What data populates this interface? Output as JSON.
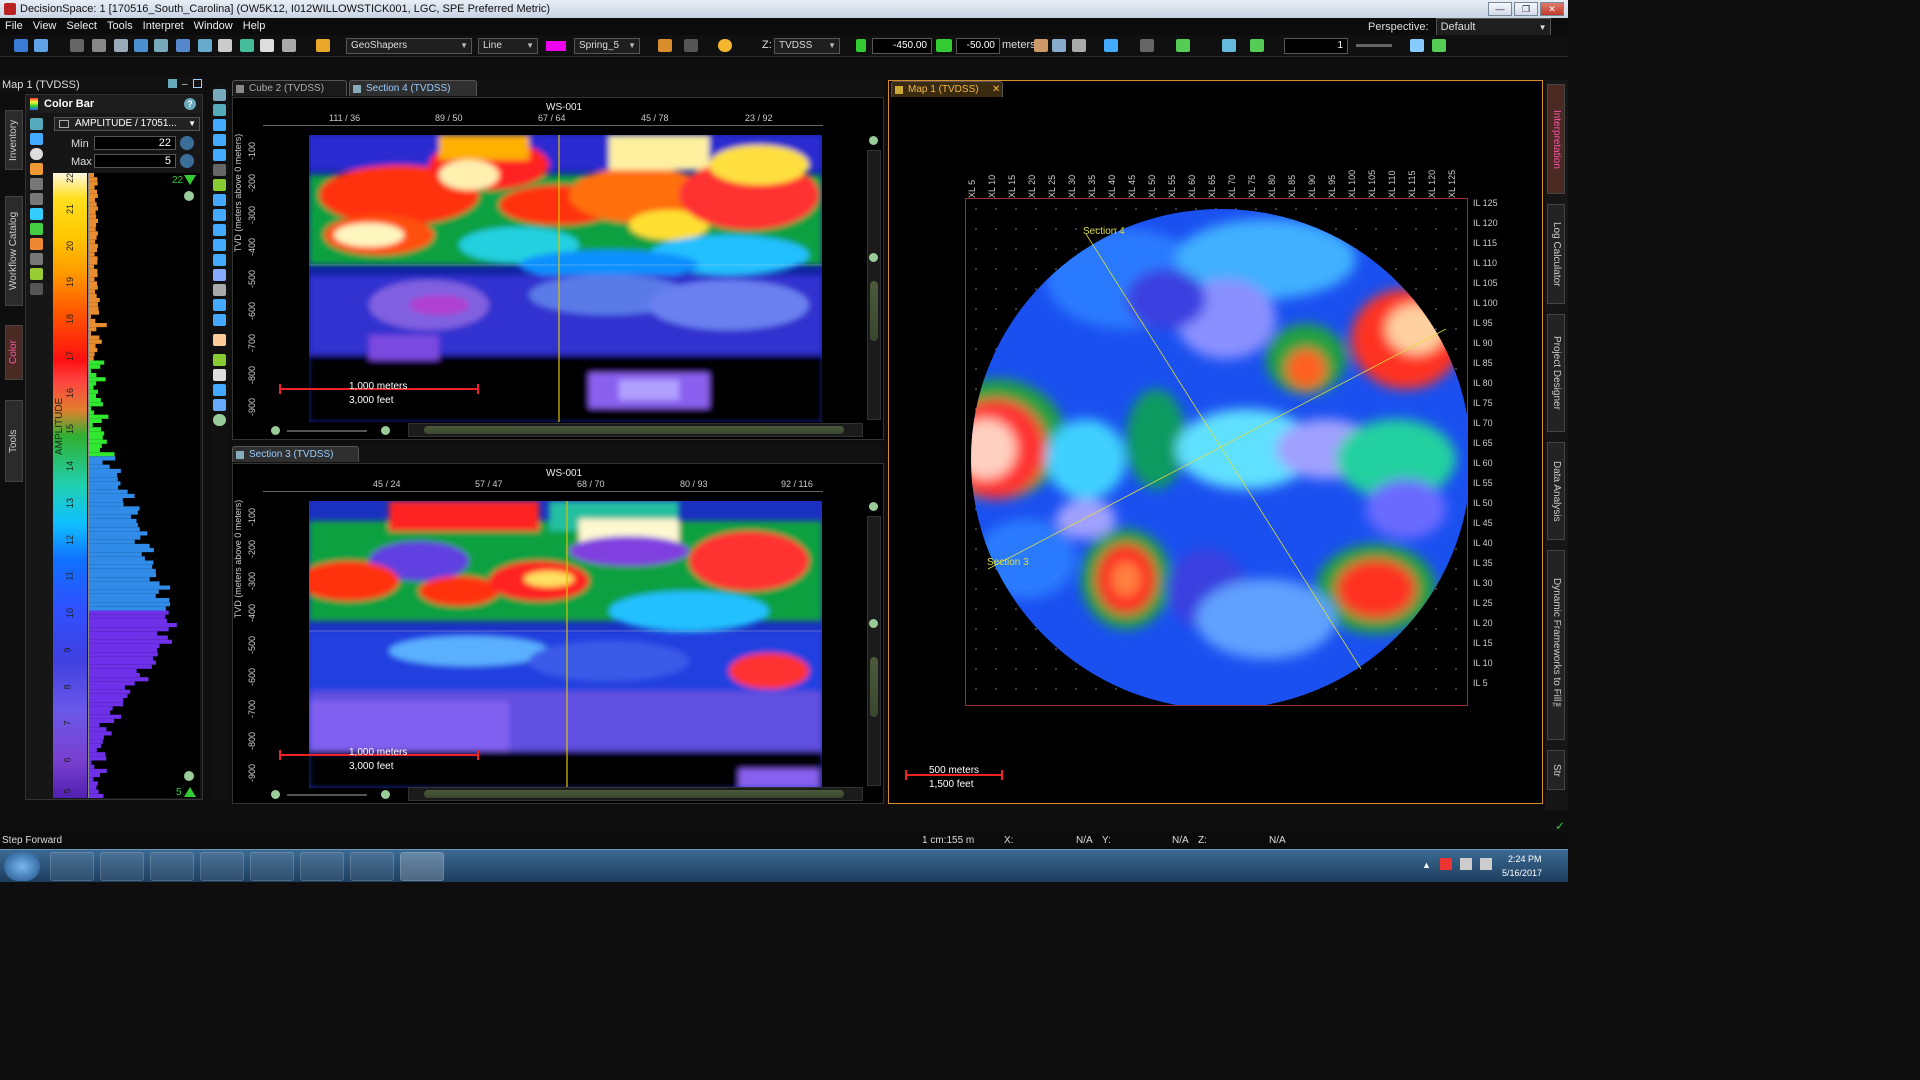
{
  "window": {
    "title": "DecisionSpace: 1 [170516_South_Carolina] (OW5K12, I012WILLOWSTICK001, LGC, SPE Preferred Metric)",
    "controls": [
      "—",
      "❐",
      "✕"
    ]
  },
  "menu": {
    "items": [
      "File",
      "View",
      "Select",
      "Tools",
      "Interpret",
      "Window",
      "Help"
    ],
    "perspective_label": "Perspective:",
    "perspective_value": "Default"
  },
  "toolbar": {
    "geoshapers": "GeoShapers",
    "line_style": "Line",
    "colormap": "Spring_5",
    "z_label": "Z:",
    "z_domain": "TVDSS",
    "z_value1": "-450.00",
    "z_value2": "-50.00",
    "units": "meters",
    "slice_value": "1"
  },
  "left_panel": {
    "header": "Map 1 (TVDSS)",
    "vertical_tabs": [
      "Inventory",
      "Workflow Catalog",
      "Color",
      "Tools"
    ],
    "color_bar": {
      "title": "Color Bar",
      "attribute": "AMPLITUDE / 17051...",
      "min_label": "Min",
      "min_value": "22",
      "max_label": "Max",
      "max_value": "5",
      "axis_label": "AMPLITUDE",
      "ticks": [
        "22",
        "21",
        "20",
        "19",
        "18",
        "17",
        "16",
        "15",
        "14",
        "13",
        "12",
        "11",
        "10",
        "9",
        "8",
        "7",
        "6",
        "5"
      ],
      "top_marker": "22",
      "bottom_marker": "5"
    }
  },
  "section_top": {
    "tabs": [
      "Cube 2 (TVDSS)",
      "Section 4 (TVDSS)"
    ],
    "well": "WS-001",
    "x_ticks": [
      "111 / 36",
      "89 / 50",
      "67 / 64",
      "45 / 78",
      "23 / 92"
    ],
    "y_label": "TVD (meters above 0 meters)",
    "y_ticks": [
      "-100",
      "-200",
      "-300",
      "-400",
      "-500",
      "-600",
      "-700",
      "-800",
      "-900"
    ],
    "scale_meters": "1,000 meters",
    "scale_feet": "3,000 feet"
  },
  "section_bottom": {
    "tab": "Section 3 (TVDSS)",
    "well": "WS-001",
    "x_ticks": [
      "45 / 24",
      "57 / 47",
      "68 / 70",
      "80 / 93",
      "92 / 116"
    ],
    "y_label": "TVD (meters above 0 meters)",
    "y_ticks": [
      "-100",
      "-200",
      "-300",
      "-400",
      "-500",
      "-600",
      "-700",
      "-800",
      "-900"
    ],
    "scale_meters": "1,000 meters",
    "scale_feet": "3,000 feet"
  },
  "map": {
    "tab": "Map 1 (TVDSS)",
    "xl_labels": [
      "XL 5",
      "XL 10",
      "XL 15",
      "XL 20",
      "XL 25",
      "XL 30",
      "XL 35",
      "XL 40",
      "XL 45",
      "XL 50",
      "XL 55",
      "XL 60",
      "XL 65",
      "XL 70",
      "XL 75",
      "XL 80",
      "XL 85",
      "XL 90",
      "XL 95",
      "XL 100",
      "XL 105",
      "XL 110",
      "XL 115",
      "XL 120",
      "XL 125"
    ],
    "il_labels": [
      "IL 125",
      "IL 120",
      "IL 115",
      "IL 110",
      "IL 105",
      "IL 100",
      "IL 95",
      "IL 90",
      "IL 85",
      "IL 80",
      "IL 75",
      "IL 70",
      "IL 65",
      "IL 60",
      "IL 55",
      "IL 50",
      "IL 45",
      "IL 40",
      "IL 35",
      "IL 30",
      "IL 25",
      "IL 20",
      "IL 15",
      "IL 10",
      "IL 5"
    ],
    "section4_label": "Section 4",
    "section3_label": "Section 3",
    "scale_meters": "500 meters",
    "scale_feet": "1,500 feet"
  },
  "right_tabs": [
    "Interpretation",
    "Log Calculator",
    "Project Designer",
    "Data Analysis",
    "Dynamic Frameworks to Fill™",
    "Str"
  ],
  "status": {
    "message": "Step Forward",
    "scale": "1 cm:155 m",
    "x_label": "X:",
    "x_value": "N/A",
    "y_label": "Y:",
    "y_value": "N/A",
    "z_label": "Z:",
    "z_value": "N/A"
  },
  "taskbar": {
    "time": "2:24 PM",
    "date": "5/16/2017"
  }
}
